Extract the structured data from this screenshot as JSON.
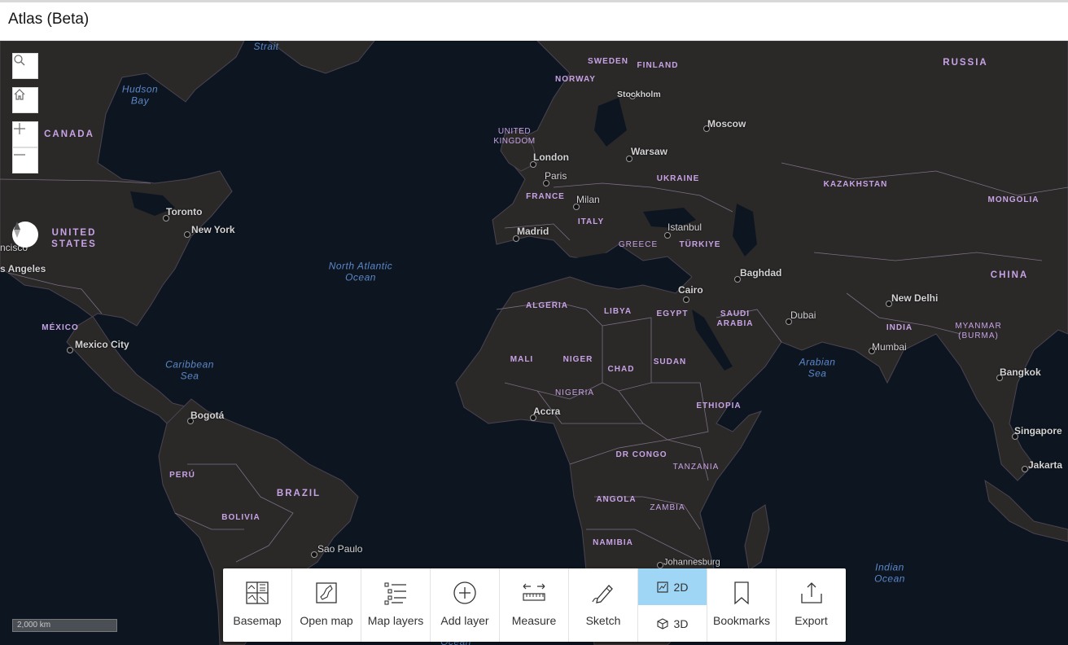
{
  "app": {
    "title": "Atlas (Beta)"
  },
  "colors": {
    "water": "#0d1620",
    "land": "#2b2828",
    "border": "#7a6f83",
    "country_label": "#c7a3e6",
    "water_label": "#5b87c8",
    "active_tool": "#9fd6f6"
  },
  "map": {
    "scale_bar": "2,000 km",
    "map_controls": [
      {
        "name": "search",
        "icon": "search-icon"
      },
      {
        "name": "home",
        "icon": "home-icon"
      },
      {
        "name": "zoom-in",
        "icon": "plus-icon"
      },
      {
        "name": "zoom-out",
        "icon": "minus-icon"
      },
      {
        "name": "compass",
        "icon": "compass-icon"
      }
    ],
    "countries": [
      "CANADA",
      "UNITED\nSTATES",
      "MÉXICO",
      "PERÚ",
      "BRAZIL",
      "BOLIVIA",
      "SWEDEN",
      "FINLAND",
      "NORWAY",
      "UNITED\nKINGDOM",
      "FRANCE",
      "ITALY",
      "GREECE",
      "UKRAINE",
      "TÜRKIYE",
      "RUSSIA",
      "KAZAKHSTAN",
      "MONGOLIA",
      "CHINA",
      "INDIA",
      "MYANMAR\n(BURMA)",
      "ALGERIA",
      "LIBYA",
      "EGYPT",
      "SAUDI\nARABIA",
      "MALI",
      "NIGER",
      "CHAD",
      "SUDAN",
      "NIGERIA",
      "ETHIOPIA",
      "DR CONGO",
      "TANZANIA",
      "ANGOLA",
      "ZAMBIA",
      "NAMIBIA"
    ],
    "water_bodies": [
      "Hudson\nBay",
      "Strait",
      "North Atlantic\nOcean",
      "Caribbean\nSea",
      "Arabian\nSea",
      "Indian\nOcean",
      "Ocean"
    ],
    "cities": [
      "Toronto",
      "New York",
      "ncisco",
      "s Angeles",
      "Mexico City",
      "Bogotá",
      "Sao Paulo",
      "London",
      "Paris",
      "Madrid",
      "Milan",
      "Stockholm",
      "Warsaw",
      "Moscow",
      "Istanbul",
      "Baghdad",
      "Cairo",
      "Dubai",
      "New Delhi",
      "Mumbai",
      "Bangkok",
      "Singapore",
      "Jakarta",
      "Accra",
      "Johannesburg"
    ]
  },
  "toolbar": {
    "items": [
      {
        "label": "Basemap",
        "icon": "basemap-icon"
      },
      {
        "label": "Open map",
        "icon": "open-map-icon"
      },
      {
        "label": "Map layers",
        "icon": "map-layers-icon"
      },
      {
        "label": "Add layer",
        "icon": "add-layer-icon"
      },
      {
        "label": "Measure",
        "icon": "measure-icon"
      },
      {
        "label": "Sketch",
        "icon": "sketch-icon"
      },
      {
        "label": "Bookmarks",
        "icon": "bookmark-icon"
      },
      {
        "label": "Export",
        "icon": "export-icon"
      }
    ],
    "view_toggle": {
      "options": [
        {
          "label": "2D",
          "icon": "2d-icon",
          "selected": true
        },
        {
          "label": "3D",
          "icon": "cube-icon",
          "selected": false
        }
      ]
    }
  }
}
